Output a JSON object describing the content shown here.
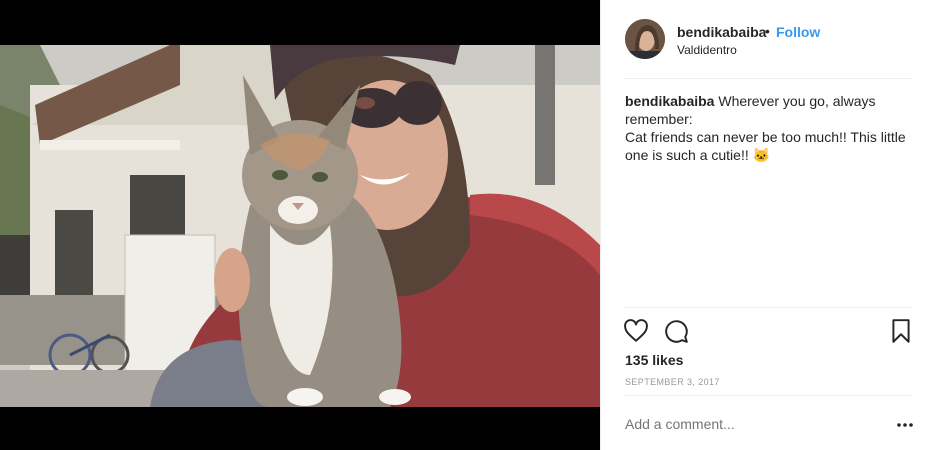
{
  "post": {
    "username": "bendikabaiba",
    "separator": "•",
    "follow_label": "Follow",
    "location": "Valdidentro",
    "caption_username": "bendikabaiba",
    "caption_text": "Wherever you go, always remember:",
    "caption_text_2": "Cat friends can never be too much!! This little one is such a cutie!!",
    "caption_emoji": "🐱",
    "likes": "135 likes",
    "date": "SEPTEMBER 3, 2017",
    "comment_placeholder": "Add a comment..."
  },
  "icons": {
    "like": "heart-icon",
    "comment": "comment-icon",
    "save": "bookmark-icon",
    "more": "more-options-icon"
  },
  "colors": {
    "follow": "#3897f0",
    "text": "#262626",
    "muted": "#999999",
    "divider": "#efefef"
  }
}
